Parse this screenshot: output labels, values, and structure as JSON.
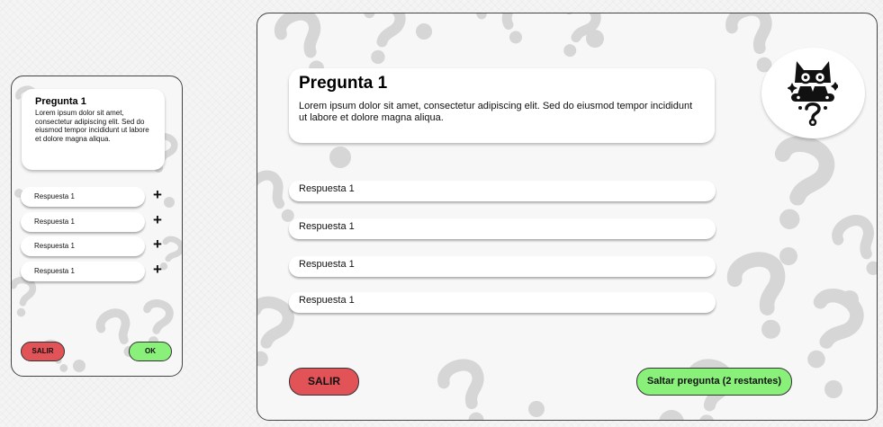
{
  "mobile": {
    "question": {
      "title": "Pregunta 1",
      "body": "Lorem ipsum dolor sit amet, consectetur adipiscing elit. Sed do eiusmod tempor incididunt ut labore et dolore magna aliqua."
    },
    "answers": [
      {
        "label": "Respuesta 1",
        "action": "+"
      },
      {
        "label": "Respuesta 1",
        "action": "+"
      },
      {
        "label": "Respuesta 1",
        "action": "+"
      },
      {
        "label": "Respuesta 1",
        "action": "+"
      }
    ],
    "exit_label": "SALIR",
    "ok_label": "OK"
  },
  "desktop": {
    "question": {
      "title": "Pregunta 1",
      "body": "Lorem ipsum dolor sit amet, consectetur adipiscing elit. Sed do eiusmod tempor incididunt ut labore et dolore magna aliqua."
    },
    "answers": [
      {
        "label": "Respuesta 1"
      },
      {
        "label": "Respuesta 1"
      },
      {
        "label": "Respuesta 1"
      },
      {
        "label": "Respuesta 1"
      }
    ],
    "exit_label": "SALIR",
    "skip_label": "Saltar pregunta (2 restantes)",
    "avatar_icon": "cat-question-mascot-icon"
  },
  "colors": {
    "exit": "#e25358",
    "confirm": "#89f07a",
    "background_question_marks": "#d6d6d6"
  }
}
